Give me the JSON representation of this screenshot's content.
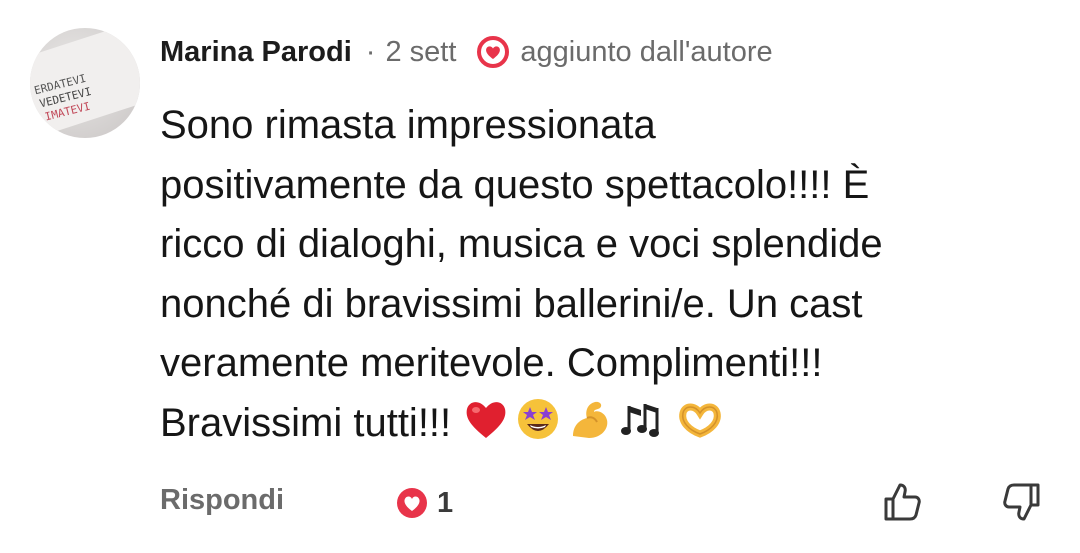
{
  "comment": {
    "author": "Marina Parodi",
    "separator": "·",
    "time": "2 sett",
    "badge_text": "aggiunto dall'autore",
    "text": "Sono rimasta impressionata\npositivamente da questo spettacolo!!!! È\nricco di dialoghi, musica e voci splendide\nnonché di bravissimi ballerini/e. Un cast\nveramente meritevole. Complimenti!!!\nBravissimi tutti!!!",
    "emojis": [
      "red-heart",
      "star-struck",
      "flexed-biceps",
      "musical-notes",
      "heart-hands"
    ],
    "avatar_lettering": [
      "ERDATEVI",
      "VEDETEVI",
      "IMATEVI"
    ]
  },
  "footer": {
    "reply_label": "Rispondi",
    "like_count": "1"
  },
  "colors": {
    "accent_red": "#e8344a",
    "meta_gray": "#6b6b6b",
    "text": "#161616"
  }
}
